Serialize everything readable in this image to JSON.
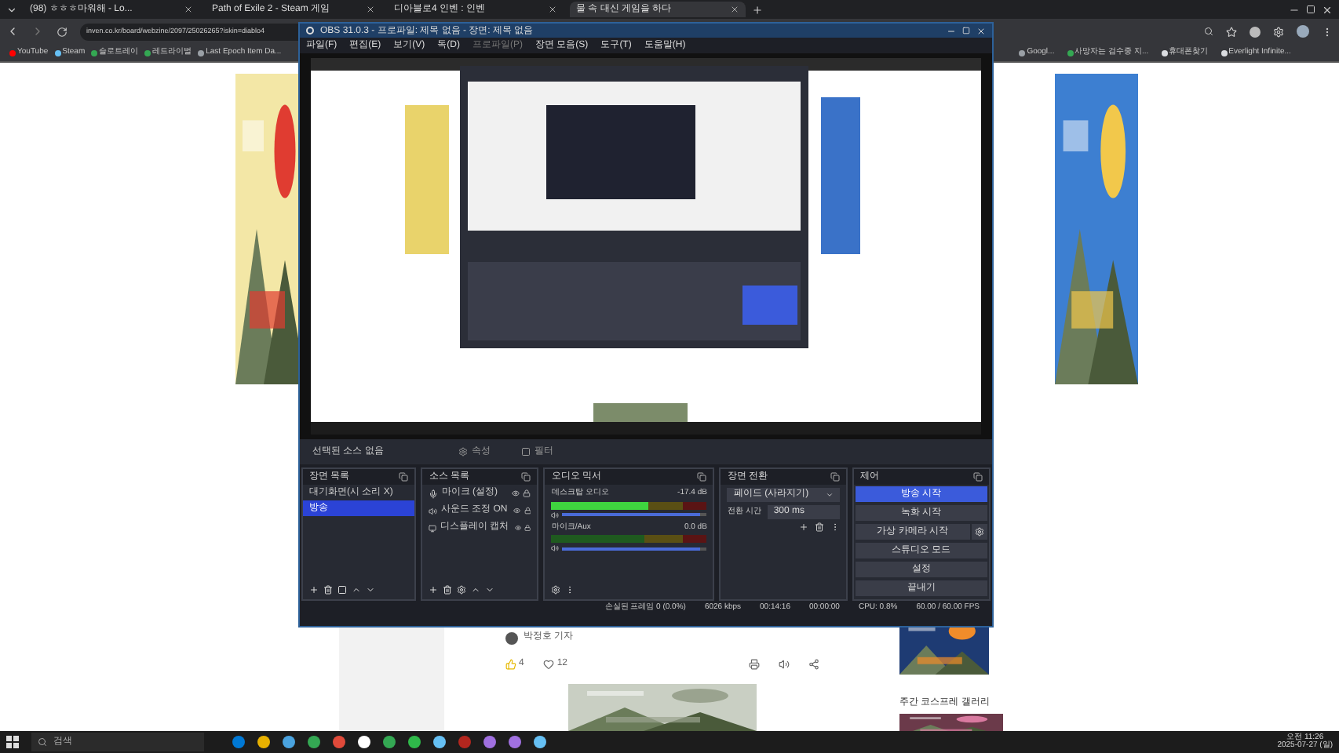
{
  "browser": {
    "tabs": [
      {
        "title": "(98) ㅎㅎㅎ마워해 - Lo...",
        "selected": false
      },
      {
        "title": "Path of Exile 2 - Steam 게임",
        "selected": false
      },
      {
        "title": "디아블로4 인벤 : 인벤",
        "selected": false
      },
      {
        "title": "물 속 대신 게임을 하다",
        "selected": true
      }
    ],
    "address": "inven.co.kr/board/webzine/2097/25026265?iskin=diablo4",
    "bookmark_groups": [
      {
        "items": [
          {
            "label": "YouTube",
            "color": "#ff0000"
          },
          {
            "label": "Steam",
            "color": "#66c0f4"
          },
          {
            "label": "슬로트레이",
            "color": "#34a853"
          },
          {
            "label": "레드라이벌",
            "color": "#34a853"
          },
          {
            "label": "Last Epoch Item Da...",
            "color": "#9aa0a6"
          }
        ]
      },
      {
        "items": [
          {
            "label": "Googl...",
            "color": "#9aa0a6"
          },
          {
            "label": "사망자는 검수중 지...",
            "color": "#34a853"
          },
          {
            "label": "휴대폰찾기",
            "color": "#dadce0"
          },
          {
            "label": "Everlight Infinite...",
            "color": "#dadce0"
          }
        ]
      }
    ]
  },
  "page": {
    "author": "박정호 기자",
    "reactions": [
      {
        "kind": "like",
        "count": "4"
      },
      {
        "kind": "heart",
        "count": "12"
      }
    ],
    "sidebar_title": "주간 코스프레 갤러리"
  },
  "obs": {
    "title": "OBS 31.0.3 - 프로파일: 제목 없음 - 장면: 제목 없음",
    "menu": [
      {
        "label": "파일(F)",
        "disabled": false
      },
      {
        "label": "편집(E)",
        "disabled": false
      },
      {
        "label": "보기(V)",
        "disabled": false
      },
      {
        "label": "독(D)",
        "disabled": false
      },
      {
        "label": "프로파일(P)",
        "disabled": true
      },
      {
        "label": "장면 모음(S)",
        "disabled": false
      },
      {
        "label": "도구(T)",
        "disabled": false
      },
      {
        "label": "도움말(H)",
        "disabled": false
      }
    ],
    "no_source": "선택된 소스 없음",
    "source_buttons": [
      "속성",
      "필터"
    ],
    "scenes": {
      "title": "장면 목록",
      "items": [
        {
          "label": "대기화면(시 소리 X)",
          "selected": false
        },
        {
          "label": "방송",
          "selected": true
        }
      ]
    },
    "sources": {
      "title": "소스 목록",
      "items": [
        {
          "label": "마이크 (설정)",
          "kind": "mic"
        },
        {
          "label": "사운드 조정 ON",
          "kind": "audio"
        },
        {
          "label": "디스플레이 캡처",
          "kind": "display"
        }
      ]
    },
    "mixer": {
      "title": "오디오 믹서",
      "channels": [
        {
          "name": "데스크탑 오디오",
          "reading": "-17.4 dB",
          "level": 0.62,
          "volume": {
            "level": 0.95
          }
        },
        {
          "name": "마이크/Aux",
          "reading": "0.0 dB",
          "volume": {
            "level": 0.95
          }
        }
      ]
    },
    "transitions": {
      "title": "장면 전환",
      "transition": "페이드 (사라지기)",
      "duration_label": "전환 시간",
      "duration": "300 ms"
    },
    "controls": {
      "title": "제어",
      "buttons": [
        {
          "label": "방송 시작",
          "selected": true,
          "kind": "plain"
        },
        {
          "label": "녹화 시작",
          "selected": false,
          "kind": "plain"
        },
        {
          "label": "가상 카메라 시작",
          "selected": false,
          "kind": "gear"
        },
        {
          "label": "스튜디오 모드",
          "selected": false,
          "kind": "plain"
        },
        {
          "label": "설정",
          "selected": false,
          "kind": "plain"
        },
        {
          "label": "끝내기",
          "selected": false,
          "kind": "plain"
        }
      ]
    },
    "status": [
      "손실된 프레임 0 (0.0%)",
      "6026 kbps",
      "00:14:16",
      "00:00:00",
      "CPU: 0.8%",
      "60.00 / 60.00 FPS"
    ]
  },
  "taskbar": {
    "search_placeholder": "검색",
    "time": "오전 11:26",
    "date": "2025-07-27 (일)"
  }
}
